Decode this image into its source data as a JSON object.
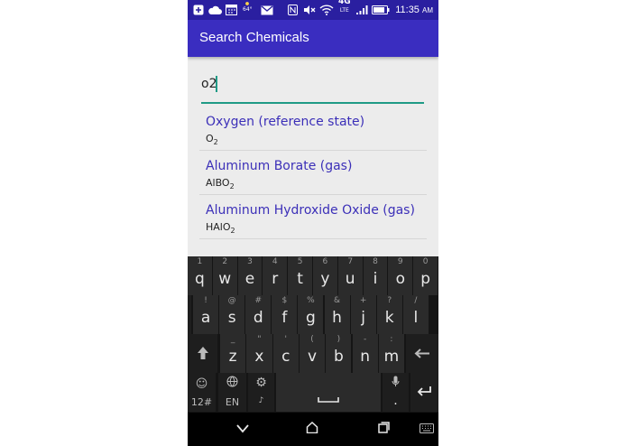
{
  "status_bar": {
    "time": "11:35",
    "ampm": "AM",
    "weather_temp": "64°",
    "network_label": "4G",
    "network_sub": "LTE",
    "icons": [
      "add-box-icon",
      "cloud-icon",
      "calendar-icon",
      "weather-icon",
      "gmail-icon",
      "nfc-icon",
      "mute-icon",
      "wifi-icon",
      "signal-icon",
      "battery-icon"
    ]
  },
  "app_bar": {
    "title": "Search Chemicals"
  },
  "search": {
    "value": "o2",
    "accent_color": "#1f9a86"
  },
  "results": [
    {
      "name": "Oxygen (reference state)",
      "formula_main": "O",
      "formula_sub": "2"
    },
    {
      "name": "Aluminum Borate (gas)",
      "formula_main": "AlBO",
      "formula_sub": "2"
    },
    {
      "name": "Aluminum Hydroxide Oxide (gas)",
      "formula_main": "HAlO",
      "formula_sub": "2"
    }
  ],
  "keyboard": {
    "row1": [
      {
        "hint": "1",
        "key": "q"
      },
      {
        "hint": "2",
        "key": "w"
      },
      {
        "hint": "3",
        "key": "e"
      },
      {
        "hint": "4",
        "key": "r"
      },
      {
        "hint": "5",
        "key": "t"
      },
      {
        "hint": "6",
        "key": "y"
      },
      {
        "hint": "7",
        "key": "u"
      },
      {
        "hint": "8",
        "key": "i"
      },
      {
        "hint": "9",
        "key": "o"
      },
      {
        "hint": "0",
        "key": "p"
      }
    ],
    "row2": [
      {
        "hint": "!",
        "key": "a"
      },
      {
        "hint": "@",
        "key": "s"
      },
      {
        "hint": "#",
        "key": "d"
      },
      {
        "hint": "$",
        "key": "f"
      },
      {
        "hint": "%",
        "key": "g"
      },
      {
        "hint": "&",
        "key": "h"
      },
      {
        "hint": "+",
        "key": "j"
      },
      {
        "hint": "?",
        "key": "k"
      },
      {
        "hint": "/",
        "key": "l"
      }
    ],
    "row3": [
      {
        "hint": "_",
        "key": "z"
      },
      {
        "hint": "\"",
        "key": "x"
      },
      {
        "hint": "'",
        "key": "c"
      },
      {
        "hint": "(",
        "key": "v"
      },
      {
        "hint": ")",
        "key": "b"
      },
      {
        "hint": "-",
        "key": "n"
      },
      {
        "hint": ":",
        "key": "m"
      }
    ],
    "symbols_label": "12#",
    "language_label": "EN",
    "period_label": ".",
    "comma_hint": ",",
    "settings_hint": "♪"
  },
  "nav_bar": {
    "icons": [
      "back-icon",
      "home-icon",
      "recents-icon",
      "keyboard-icon"
    ]
  },
  "colors": {
    "status_bar": "#2a1fa0",
    "app_bar": "#3a2dc0",
    "result_text": "#3b2fb8"
  }
}
